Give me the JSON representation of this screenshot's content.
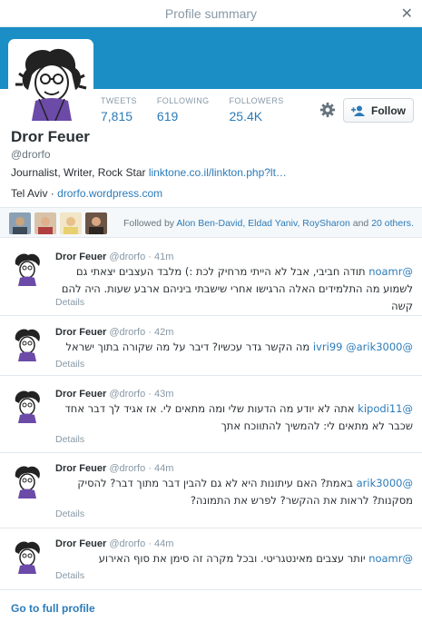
{
  "window": {
    "title": "Profile summary"
  },
  "profile": {
    "name": "Dror Feuer",
    "handle": "@drorfo",
    "bio": "Journalist, Writer, Rock Star ",
    "bio_link": "linktone.co.il/linkton.php?lt…",
    "location": "Tel Aviv",
    "location_separator": " · ",
    "website": "drorfo.wordpress.com",
    "banner_color": "#1b8ec6"
  },
  "stats": [
    {
      "label": "TWEETS",
      "value": "7,815"
    },
    {
      "label": "FOLLOWING",
      "value": "619"
    },
    {
      "label": "FOLLOWERS",
      "value": "25.4K"
    }
  ],
  "follow_button": {
    "label": "Follow"
  },
  "followed_by": {
    "prefix": "Followed by ",
    "names": "Alon Ben-David, Eldad Yaniv, RoySharon",
    "suffix": " and ",
    "others": "20 others."
  },
  "tweets": [
    {
      "name": "Dror Feuer",
      "handle": "@drorfo",
      "time": "· 41m",
      "mention": "@noamr",
      "text": " תודה חביבי, אבל לא הייתי מרחיק לכת :) מלבד העצבים יצאתי גם לשמוע מה התלמידים האלה הרגישו אחרי שישבתי ביניהם ארבע שעות. היה להם קשה",
      "details": "Details"
    },
    {
      "name": "Dror Feuer",
      "handle": "@drorfo",
      "time": "· 42m",
      "mention": "@ivri99 @arik3000",
      "text": " מה הקשר גדר עכשיו? דיבר על מה שקורה בתוך ישראל",
      "details": "Details"
    },
    {
      "name": "Dror Feuer",
      "handle": "@drorfo",
      "time": "· 43m",
      "mention": "@kipodi11",
      "text": " אתה לא יודע מה הדעות שלי ומה מתאים לי. אז אגיד לך דבר אחד שכבר לא מתאים לי: להמשיך להתווכח אתך",
      "details": "Details"
    },
    {
      "name": "Dror Feuer",
      "handle": "@drorfo",
      "time": "· 44m",
      "mention": "@arik3000",
      "text": " באמת? האם עיתונות היא לא גם להבין דבר מתוך דבר? להסיק מסקנות? לראות את ההקשר? לפרש את התמונה?",
      "details": "Details"
    },
    {
      "name": "Dror Feuer",
      "handle": "@drorfo",
      "time": "· 44m",
      "mention": "@noamr",
      "text": " יותר עצבים מאינטגריטי. ובכל מקרה זה סימן את סוף האירוע",
      "details": "Details"
    }
  ],
  "footer": {
    "full_profile": "Go to full profile"
  }
}
